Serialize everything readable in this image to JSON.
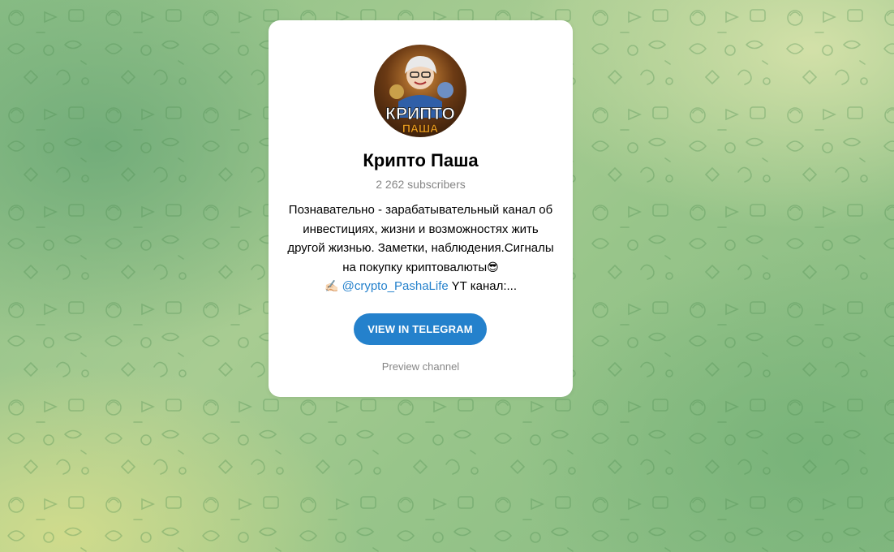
{
  "channel": {
    "title": "Крипто Паша",
    "subscribers": "2 262 subscribers",
    "description": {
      "line1": "Познавательно - зарабатывательный канал об",
      "line2": "инвестициях, жизни и возможностях жить",
      "line3": "другой жизнью. Заметки, наблюдения.Сигналы",
      "line4_text": "на покупку криптовалюты",
      "line4_emoji": "😎",
      "line5_emoji": "✍🏻",
      "line5_link": "@crypto_PashaLife",
      "line5_rest": " YT канал:..."
    },
    "avatar_text_top": "КРИПТО",
    "avatar_text_bottom": "ПАША"
  },
  "actions": {
    "view_label": "VIEW IN TELEGRAM",
    "preview_label": "Preview channel"
  },
  "colors": {
    "accent": "#2481cc",
    "muted": "#868686",
    "card": "#ffffff"
  }
}
